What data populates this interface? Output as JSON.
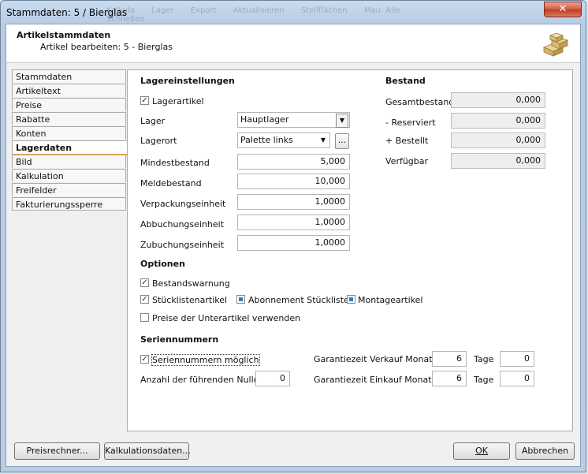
{
  "window": {
    "title": "Stammdaten: 5 / Bierglas",
    "close_glyph": "✕"
  },
  "ghost_toolbar": [
    "Kalkula",
    "Lager",
    "Export",
    "Aktualisieren",
    "Stellflächen",
    "Mau. Alle",
    "Schließen"
  ],
  "header": {
    "title": "Artikelstammdaten",
    "subtitle": "Artikel bearbeiten: 5 - Bierglas",
    "icon": "boxes-icon"
  },
  "nav": {
    "items": [
      {
        "label": "Stammdaten"
      },
      {
        "label": "Artikeltext"
      },
      {
        "label": "Preise"
      },
      {
        "label": "Rabatte"
      },
      {
        "label": "Konten"
      },
      {
        "label": "Lagerdaten",
        "active": true
      },
      {
        "label": "Bild"
      },
      {
        "label": "Kalkulation"
      },
      {
        "label": "Freifelder"
      },
      {
        "label": "Fakturierungssperre"
      }
    ]
  },
  "lager": {
    "section_title": "Lagereinstellungen",
    "lagerartikel_label": "Lagerartikel",
    "lagerartikel_checked": true,
    "lager_label": "Lager",
    "lager_value": "Hauptlager",
    "lagerort_label": "Lagerort",
    "lagerort_value": "Palette links",
    "lagerort_button": "...",
    "mindestbestand_label": "Mindestbestand",
    "mindestbestand_value": "5,000",
    "meldebestand_label": "Meldebestand",
    "meldebestand_value": "10,000",
    "verpackungseinheit_label": "Verpackungseinheit",
    "verpackungseinheit_value": "1,0000",
    "abbuchungseinheit_label": "Abbuchungseinheit",
    "abbuchungseinheit_value": "1,0000",
    "zubuchungseinheit_label": "Zubuchungseinheit",
    "zubuchungseinheit_value": "1,0000"
  },
  "bestand": {
    "section_title": "Bestand",
    "gesamt_label": "Gesamtbestand",
    "gesamt_value": "0,000",
    "reserviert_label": "- Reserviert",
    "reserviert_value": "0,000",
    "bestellt_label": "+ Bestellt",
    "bestellt_value": "0,000",
    "verfuegbar_label": "Verfügbar",
    "verfuegbar_value": "0,000"
  },
  "optionen": {
    "section_title": "Optionen",
    "bestandswarnung_label": "Bestandswarnung",
    "stueckliste_label": "Stücklistenartikel",
    "abonnement_label": "Abonnement Stückliste",
    "montage_label": "Montageartikel",
    "unterartikel_label": "Preise der Unterartikel verwenden"
  },
  "serien": {
    "section_title": "Seriennummern",
    "moeglich_label": "Seriennummern möglich",
    "nullen_label": "Anzahl der führenden Nullen",
    "nullen_value": "0",
    "verkauf_label": "Garantiezeit Verkauf Monate",
    "verkauf_monate": "6",
    "verkauf_tage_label": "Tage",
    "verkauf_tage": "0",
    "einkauf_label": "Garantiezeit Einkauf Monate",
    "einkauf_monate": "6",
    "einkauf_tage_label": "Tage",
    "einkauf_tage": "0"
  },
  "footer": {
    "preisrechner": "Preisrechner...",
    "kalkulationsdaten": "Kalkulationsdaten...",
    "ok": "OK",
    "abbrechen": "Abbrechen"
  }
}
